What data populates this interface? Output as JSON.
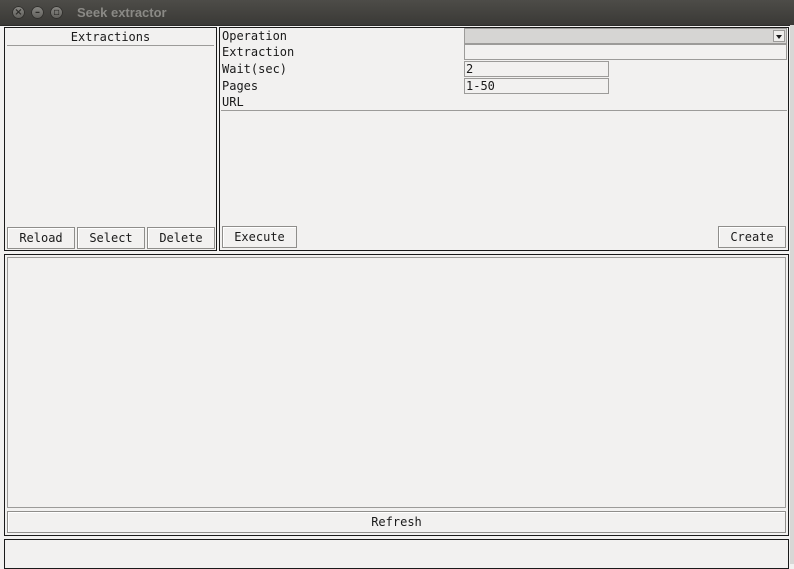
{
  "window": {
    "title": "Seek extractor"
  },
  "extractions_panel": {
    "header": "Extractions",
    "reload_label": "Reload",
    "select_label": "Select",
    "delete_label": "Delete"
  },
  "form": {
    "operation_label": "Operation",
    "operation_value": "",
    "extraction_label": "Extraction",
    "extraction_value": "",
    "wait_label": "Wait(sec)",
    "wait_value": "2",
    "pages_label": "Pages",
    "pages_value": "1-50",
    "url_label": "URL",
    "url_value": ""
  },
  "actions": {
    "execute_label": "Execute",
    "create_label": "Create"
  },
  "results": {
    "refresh_label": "Refresh"
  }
}
